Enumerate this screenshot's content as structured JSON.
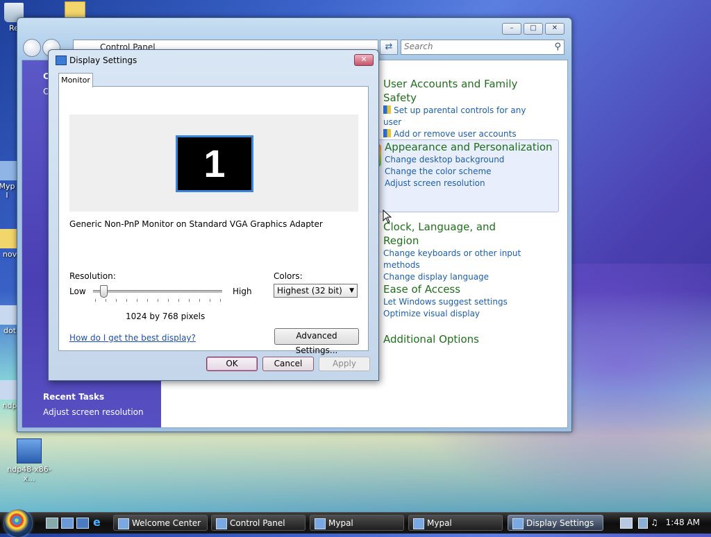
{
  "desktop": {
    "icons": [
      {
        "label": "Re"
      },
      {
        "label": "Myp\nI"
      },
      {
        "label": "nov"
      },
      {
        "label": "dot"
      },
      {
        "label": "ndp"
      },
      {
        "label": "ndp48-x86-x..."
      }
    ]
  },
  "control_panel": {
    "address": "Control Panel",
    "search_placeholder": "Search",
    "left_items": [
      "C",
      "C"
    ],
    "recent_tasks_title": "Recent Tasks",
    "recent_tasks": [
      "Adjust screen resolution"
    ],
    "categories": [
      {
        "title": "User Accounts and Family Safety",
        "links": [
          "Set up parental controls for any user",
          "Add or remove user accounts"
        ]
      },
      {
        "title": "Appearance and Personalization",
        "links": [
          "Change desktop background",
          "Change the color scheme",
          "Adjust screen resolution"
        ]
      },
      {
        "title": "Clock, Language, and Region",
        "links": [
          "Change keyboards or other input methods",
          "Change display language"
        ]
      },
      {
        "title": "Ease of Access",
        "links": [
          "Let Windows suggest settings",
          "Optimize visual display"
        ]
      },
      {
        "title": "Additional Options",
        "links": []
      }
    ]
  },
  "dialog": {
    "title": "Display Settings",
    "tab": "Monitor",
    "monitor_number": "1",
    "monitor_description": "Generic Non-PnP Monitor on Standard VGA Graphics Adapter",
    "resolution_label": "Resolution:",
    "low_label": "Low",
    "high_label": "High",
    "resolution_value": "1024 by 768 pixels",
    "slider_level_fraction": 0.08,
    "colors_label": "Colors:",
    "colors_value": "Highest (32 bit)",
    "help_link": "How do I get the best display?",
    "advanced_button": "Advanced Settings...",
    "ok": "OK",
    "cancel": "Cancel",
    "apply": "Apply"
  },
  "taskbar": {
    "buttons": [
      "Welcome Center",
      "Control Panel",
      "Mypal",
      "Mypal",
      "Display Settings"
    ],
    "clock": "1:48 AM"
  },
  "colors": {
    "category_title": "#1f6f1a",
    "link": "#1c5fa8",
    "accent": "#3b86d8"
  }
}
